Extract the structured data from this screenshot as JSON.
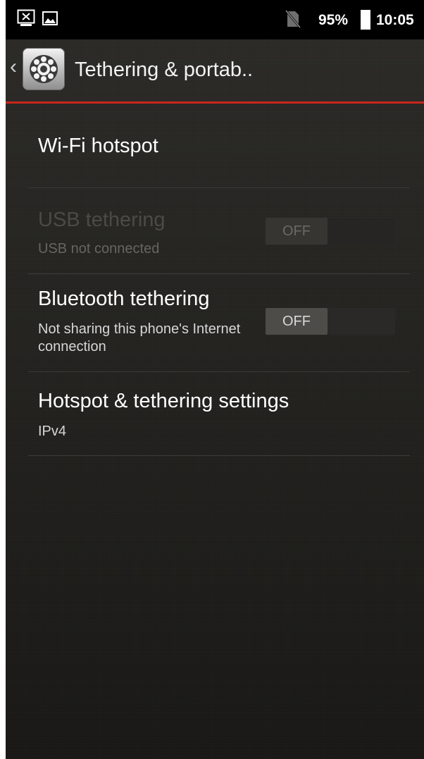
{
  "status_bar": {
    "battery_percent": "95%",
    "battery_level": 0.95,
    "time": "10:05",
    "icons": [
      "screenshot-notification-icon",
      "image-notification-icon",
      "no-sim-icon",
      "battery-icon"
    ]
  },
  "action_bar": {
    "back_glyph": "‹",
    "title": "Tethering & portab..",
    "icon": "settings-gear-icon"
  },
  "items": [
    {
      "title": "Wi-Fi hotspot"
    },
    {
      "title": "USB tethering",
      "subtitle": "USB not connected",
      "toggle": "OFF",
      "enabled": false
    },
    {
      "title": "Bluetooth tethering",
      "subtitle": "Not sharing this phone's Internet connection",
      "toggle": "OFF",
      "enabled": true
    },
    {
      "title": "Hotspot & tethering settings",
      "subtitle": "IPv4"
    }
  ],
  "colors": {
    "accent_divider": "#c8261c",
    "background": "#242320",
    "text_primary": "#ffffff",
    "text_disabled": "#4b4a47"
  }
}
